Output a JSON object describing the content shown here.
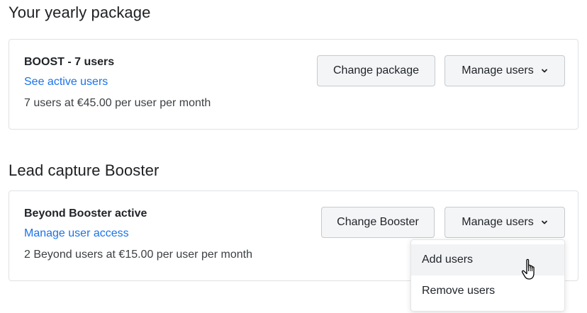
{
  "sections": [
    {
      "title": "Your yearly package",
      "heading": "BOOST - 7 users",
      "link": "See active users",
      "detail": "7 users at €45.00 per user per month",
      "primary_button": "Change package",
      "manage_button": "Manage users"
    },
    {
      "title": "Lead capture Booster",
      "heading_strong": "Beyond",
      "heading_rest": " Booster active",
      "link": "Manage user access",
      "detail": "2 Beyond users at €15.00 per user per month",
      "primary_button": "Change Booster",
      "manage_button": "Manage users"
    }
  ],
  "dropdown": {
    "items": [
      {
        "label": "Add users",
        "hovered": true
      },
      {
        "label": "Remove users",
        "hovered": false
      }
    ]
  },
  "icons": {
    "dropdown_chevron": "chevron-down-icon",
    "pointer": "hand-pointer-cursor-icon"
  },
  "colors": {
    "link": "#1a73e8",
    "button_bg": "#f4f5f6",
    "border": "#dfe1e4"
  }
}
